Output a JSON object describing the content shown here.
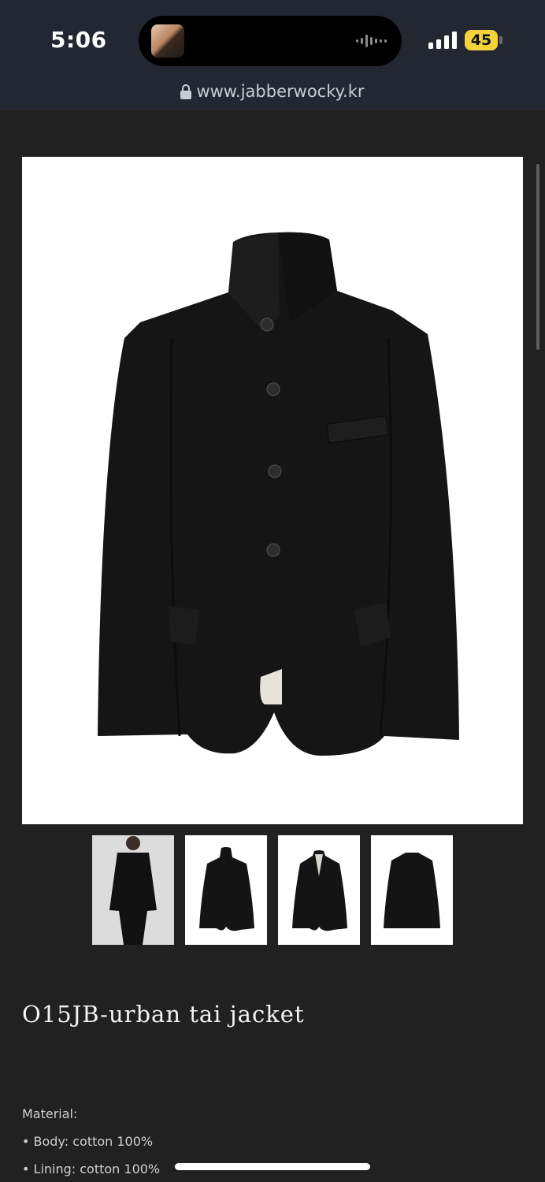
{
  "status": {
    "time": "5:06",
    "battery": "45"
  },
  "browser": {
    "url": "www.jabberwocky.kr"
  },
  "product": {
    "title": "O15JB-urban tai jacket",
    "material_label": "Material:",
    "materials": [
      "• Body: cotton 100%",
      "• Lining: cotton 100%"
    ]
  },
  "icons": {
    "lock": "lock-icon",
    "signal": "signal-icon",
    "battery": "battery-icon",
    "audio": "audio-wave-icon"
  }
}
